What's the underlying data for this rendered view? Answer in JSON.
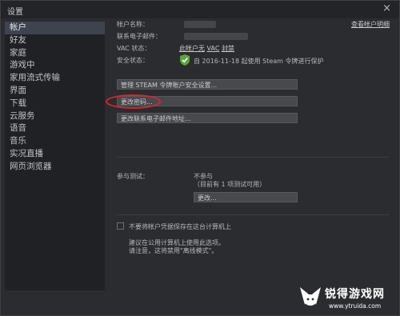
{
  "window": {
    "title": "设置",
    "close_glyph": "×"
  },
  "sidebar": {
    "items": [
      {
        "label": "帐户"
      },
      {
        "label": "好友"
      },
      {
        "label": "家庭"
      },
      {
        "label": "游戏中"
      },
      {
        "label": "家用流式传输"
      },
      {
        "label": "界面"
      },
      {
        "label": "下载"
      },
      {
        "label": "云服务"
      },
      {
        "label": "语音"
      },
      {
        "label": "音乐"
      },
      {
        "label": "实况直播"
      },
      {
        "label": "网页浏览器"
      }
    ]
  },
  "account": {
    "name_label": "帐户名称：",
    "view_details_link": "查看帐户明细",
    "email_label": "联系电子邮件：",
    "vac_label": "VAC 状态：",
    "vac_value": "此帐户无",
    "vac_link": "VAC",
    "vac_ban_link": "封禁",
    "security_label": "安全状态：",
    "security_value": "自 2016-11-18 起使用 Steam 令牌进行保护",
    "shield_icon": "shield-check-icon",
    "shield_color": "#5aa63b"
  },
  "buttons": {
    "manage_guard": "管理 STEAM 令牌帐户安全设置...",
    "change_password": "更改密码...",
    "change_email": "更改联系电子邮件地址..."
  },
  "beta": {
    "label": "参与测试：",
    "status": "不参与",
    "available": "（目前有 1 项测试可用）",
    "change_button": "更改..."
  },
  "remember": {
    "checkbox_label": "不要将帐户凭据保存在这台计算机上",
    "hint_line1": "建议在公用计算机上使用此选项。",
    "hint_line2": "请注意，这将禁用\"离线模式\"。"
  },
  "annotation": {
    "color": "#d8262c"
  },
  "watermark": {
    "name": "锐得游戏网",
    "url": "www.ytruida.com"
  }
}
